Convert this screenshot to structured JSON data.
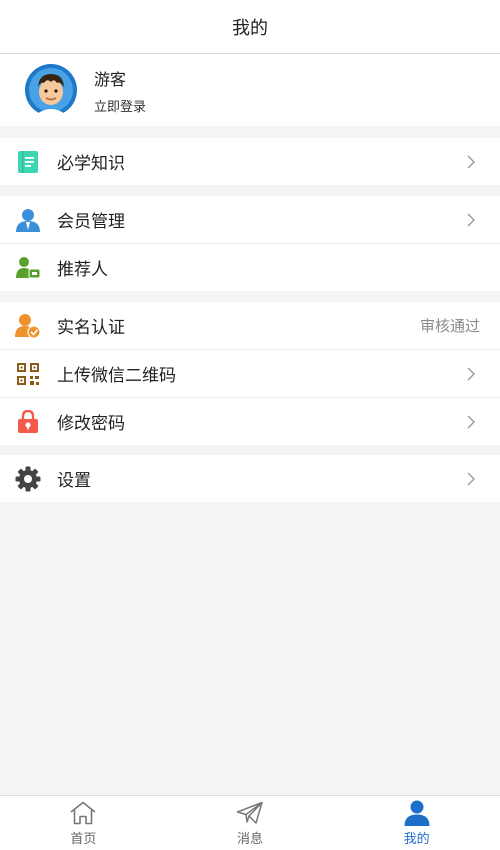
{
  "header": {
    "title": "我的"
  },
  "profile": {
    "name": "游客",
    "login_text": "立即登录"
  },
  "groups": [
    {
      "items": [
        {
          "label": "必学知识",
          "icon": "book-icon",
          "color": "#3dd6b5"
        }
      ]
    },
    {
      "items": [
        {
          "label": "会员管理",
          "icon": "member-icon",
          "color": "#3a8fd8"
        },
        {
          "label": "推荐人",
          "icon": "referrer-icon",
          "color": "#5aa02c"
        }
      ]
    },
    {
      "items": [
        {
          "label": "实名认证",
          "icon": "verify-icon",
          "color": "#f0922b",
          "status": "审核通过"
        },
        {
          "label": "上传微信二维码",
          "icon": "qrcode-icon",
          "color": "#8b5a16"
        },
        {
          "label": "修改密码",
          "icon": "lock-icon",
          "color": "#f25b4a"
        }
      ]
    },
    {
      "items": [
        {
          "label": "设置",
          "icon": "gear-icon",
          "color": "#444444"
        }
      ]
    }
  ],
  "tabbar": {
    "home": "首页",
    "messages": "消息",
    "mine": "我的"
  },
  "colors": {
    "accent": "#1e6fc9",
    "background": "#f4f4f4"
  }
}
